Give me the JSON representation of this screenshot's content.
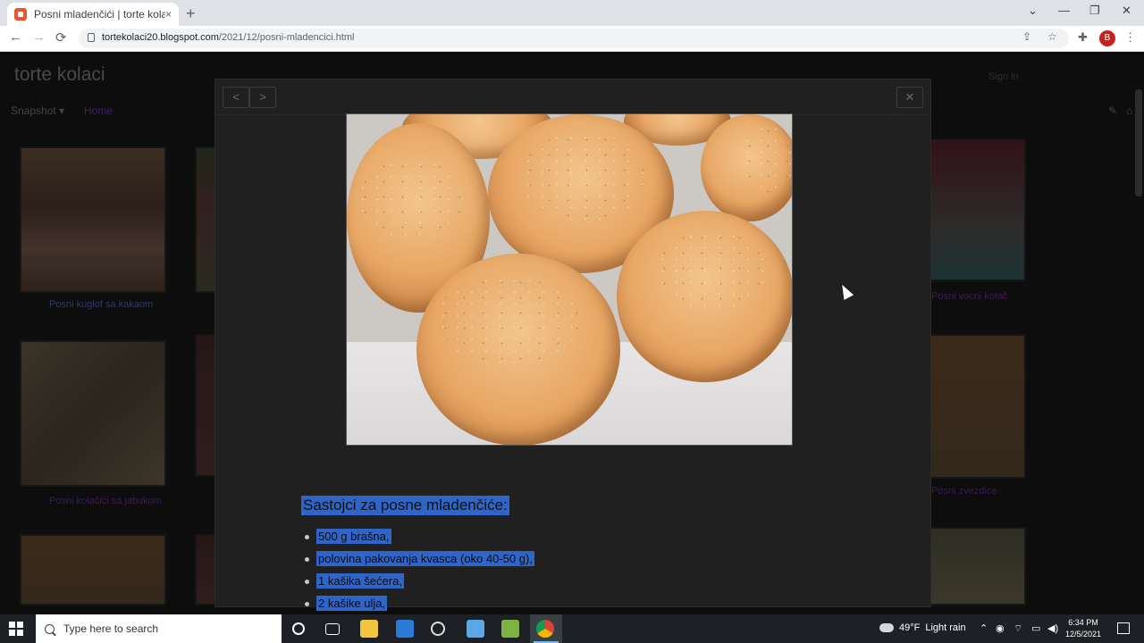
{
  "browser": {
    "tab_title": "Posni mladenčići | torte kolaci",
    "tab_close": "×",
    "new_tab": "+",
    "win_min": "—",
    "win_restore": "❐",
    "win_close": "✕",
    "back": "←",
    "forward": "→",
    "reload": "⟳",
    "url_domain": "tortekolaci20.blogspot.com",
    "url_path": "/2021/12/posni-mladencici.html",
    "profile_initial": "B"
  },
  "blog": {
    "title": "torte kolaci",
    "signin": "Sign in",
    "nav_snapshot": "Snapshot",
    "nav_home": "Home",
    "thumb_captions": [
      "Posni kuglof sa kakaom",
      "Posni kolačići sa jabukom",
      "Posni voćni kolač",
      "Posni zvezdice"
    ]
  },
  "lightbox": {
    "prev": "<",
    "next": ">",
    "close": "✕",
    "heading": "Sastojci za posne mladenčiće:",
    "ingredients": [
      "500 g brašna,",
      "polovina pakovanja kvasca (oko 40-50 g),",
      "1 kašika šećera,",
      "2 kašike ulja,"
    ]
  },
  "taskbar": {
    "search_placeholder": "Type here to search",
    "weather_temp": "49°F",
    "weather_text": "Light rain",
    "time": "6:34 PM",
    "date": "12/5/2021"
  },
  "colors": {
    "selection": "#2f64c8",
    "page_bg": "#0d0d0d",
    "lightbox_bg": "#202020"
  }
}
